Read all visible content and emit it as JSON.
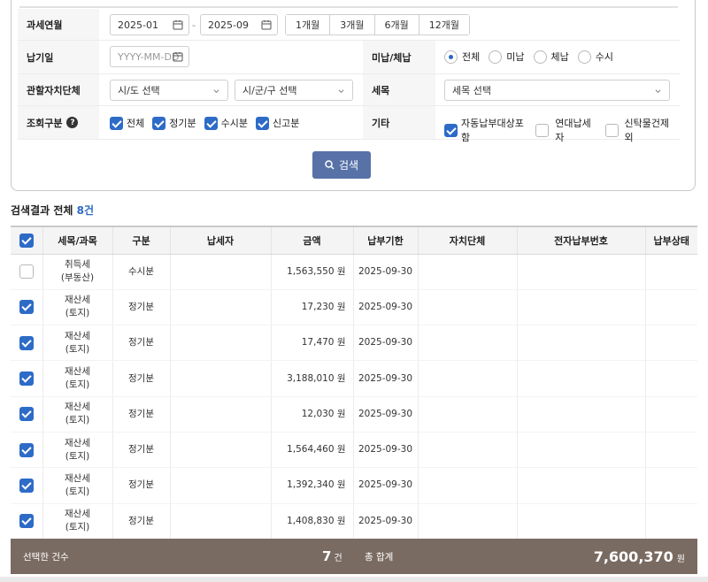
{
  "filters": {
    "tax_month": {
      "label": "과세연월",
      "from": "2025-01",
      "sep": "-",
      "to": "2025-09",
      "periods": [
        "1개월",
        "3개월",
        "6개월",
        "12개월"
      ]
    },
    "pay_date": {
      "label": "납기일",
      "placeholder": "YYYY-MM-DD"
    },
    "unpaid": {
      "label": "미납/체납",
      "options": [
        "전체",
        "미납",
        "체납",
        "수시"
      ],
      "selected": "전체"
    },
    "local_gov": {
      "label": "관할자치단체",
      "sido": "시/도 선택",
      "sigungu": "시/군/구 선택"
    },
    "tax_item": {
      "label": "세목",
      "value": "세목 선택"
    },
    "query_type": {
      "label": "조회구분",
      "help": "?",
      "options": [
        "전체",
        "정기분",
        "수시분",
        "신고분"
      ]
    },
    "etc": {
      "label": "기타",
      "options": [
        "자동납부대상포함",
        "연대납세자",
        "신탁물건제외"
      ]
    },
    "search_button": "검색"
  },
  "results": {
    "title_prefix": "검색결과 전체 ",
    "count": "8건",
    "columns": [
      "세목/과목",
      "구분",
      "납세자",
      "금액",
      "납부기한",
      "자치단체",
      "전자납부번호",
      "납부상태"
    ],
    "rows": [
      {
        "checked": false,
        "tax1": "취득세",
        "tax2": "(부동산)",
        "type": "수시분",
        "amount": "1,563,550 원",
        "due": "2025-09-30"
      },
      {
        "checked": true,
        "tax1": "재산세",
        "tax2": "(토지)",
        "type": "정기분",
        "amount": "17,230 원",
        "due": "2025-09-30"
      },
      {
        "checked": true,
        "tax1": "재산세",
        "tax2": "(토지)",
        "type": "정기분",
        "amount": "17,470 원",
        "due": "2025-09-30"
      },
      {
        "checked": true,
        "tax1": "재산세",
        "tax2": "(토지)",
        "type": "정기분",
        "amount": "3,188,010 원",
        "due": "2025-09-30"
      },
      {
        "checked": true,
        "tax1": "재산세",
        "tax2": "(토지)",
        "type": "정기분",
        "amount": "12,030 원",
        "due": "2025-09-30"
      },
      {
        "checked": true,
        "tax1": "재산세",
        "tax2": "(토지)",
        "type": "정기분",
        "amount": "1,564,460 원",
        "due": "2025-09-30"
      },
      {
        "checked": true,
        "tax1": "재산세",
        "tax2": "(토지)",
        "type": "정기분",
        "amount": "1,392,340 원",
        "due": "2025-09-30"
      },
      {
        "checked": true,
        "tax1": "재산세",
        "tax2": "(토지)",
        "type": "정기분",
        "amount": "1,408,830 원",
        "due": "2025-09-30"
      }
    ]
  },
  "footer": {
    "selected_label": "선택한 건수",
    "selected_count": "7",
    "count_unit": "건",
    "total_label": "총 합계",
    "total_amount": "7,600,370",
    "amount_unit": "원"
  },
  "colors": {
    "accent": "#2d6bc7",
    "search_button": "#5872a8",
    "footer_bg": "#7a6b62"
  }
}
